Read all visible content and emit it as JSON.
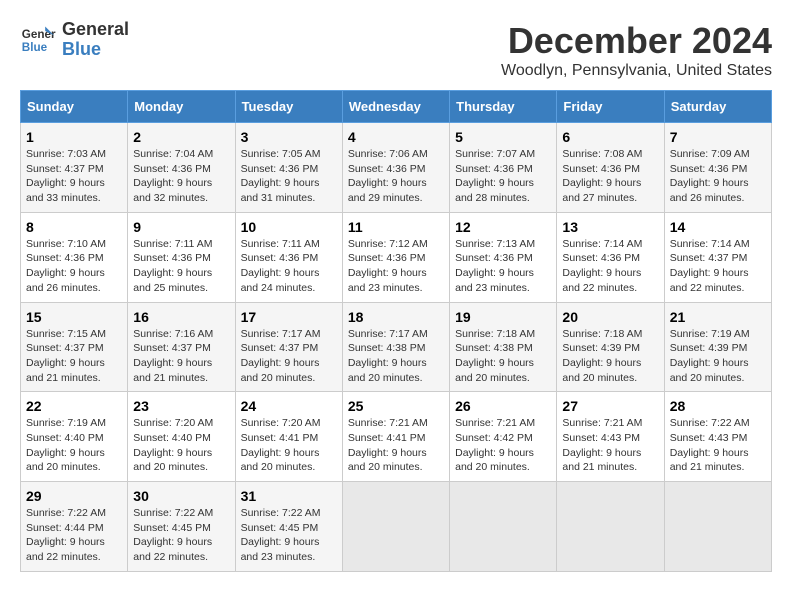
{
  "header": {
    "logo_line1": "General",
    "logo_line2": "Blue",
    "main_title": "December 2024",
    "subtitle": "Woodlyn, Pennsylvania, United States"
  },
  "columns": [
    "Sunday",
    "Monday",
    "Tuesday",
    "Wednesday",
    "Thursday",
    "Friday",
    "Saturday"
  ],
  "weeks": [
    [
      {
        "day": "1",
        "sunrise": "Sunrise: 7:03 AM",
        "sunset": "Sunset: 4:37 PM",
        "daylight": "Daylight: 9 hours and 33 minutes."
      },
      {
        "day": "2",
        "sunrise": "Sunrise: 7:04 AM",
        "sunset": "Sunset: 4:36 PM",
        "daylight": "Daylight: 9 hours and 32 minutes."
      },
      {
        "day": "3",
        "sunrise": "Sunrise: 7:05 AM",
        "sunset": "Sunset: 4:36 PM",
        "daylight": "Daylight: 9 hours and 31 minutes."
      },
      {
        "day": "4",
        "sunrise": "Sunrise: 7:06 AM",
        "sunset": "Sunset: 4:36 PM",
        "daylight": "Daylight: 9 hours and 29 minutes."
      },
      {
        "day": "5",
        "sunrise": "Sunrise: 7:07 AM",
        "sunset": "Sunset: 4:36 PM",
        "daylight": "Daylight: 9 hours and 28 minutes."
      },
      {
        "day": "6",
        "sunrise": "Sunrise: 7:08 AM",
        "sunset": "Sunset: 4:36 PM",
        "daylight": "Daylight: 9 hours and 27 minutes."
      },
      {
        "day": "7",
        "sunrise": "Sunrise: 7:09 AM",
        "sunset": "Sunset: 4:36 PM",
        "daylight": "Daylight: 9 hours and 26 minutes."
      }
    ],
    [
      {
        "day": "8",
        "sunrise": "Sunrise: 7:10 AM",
        "sunset": "Sunset: 4:36 PM",
        "daylight": "Daylight: 9 hours and 26 minutes."
      },
      {
        "day": "9",
        "sunrise": "Sunrise: 7:11 AM",
        "sunset": "Sunset: 4:36 PM",
        "daylight": "Daylight: 9 hours and 25 minutes."
      },
      {
        "day": "10",
        "sunrise": "Sunrise: 7:11 AM",
        "sunset": "Sunset: 4:36 PM",
        "daylight": "Daylight: 9 hours and 24 minutes."
      },
      {
        "day": "11",
        "sunrise": "Sunrise: 7:12 AM",
        "sunset": "Sunset: 4:36 PM",
        "daylight": "Daylight: 9 hours and 23 minutes."
      },
      {
        "day": "12",
        "sunrise": "Sunrise: 7:13 AM",
        "sunset": "Sunset: 4:36 PM",
        "daylight": "Daylight: 9 hours and 23 minutes."
      },
      {
        "day": "13",
        "sunrise": "Sunrise: 7:14 AM",
        "sunset": "Sunset: 4:36 PM",
        "daylight": "Daylight: 9 hours and 22 minutes."
      },
      {
        "day": "14",
        "sunrise": "Sunrise: 7:14 AM",
        "sunset": "Sunset: 4:37 PM",
        "daylight": "Daylight: 9 hours and 22 minutes."
      }
    ],
    [
      {
        "day": "15",
        "sunrise": "Sunrise: 7:15 AM",
        "sunset": "Sunset: 4:37 PM",
        "daylight": "Daylight: 9 hours and 21 minutes."
      },
      {
        "day": "16",
        "sunrise": "Sunrise: 7:16 AM",
        "sunset": "Sunset: 4:37 PM",
        "daylight": "Daylight: 9 hours and 21 minutes."
      },
      {
        "day": "17",
        "sunrise": "Sunrise: 7:17 AM",
        "sunset": "Sunset: 4:37 PM",
        "daylight": "Daylight: 9 hours and 20 minutes."
      },
      {
        "day": "18",
        "sunrise": "Sunrise: 7:17 AM",
        "sunset": "Sunset: 4:38 PM",
        "daylight": "Daylight: 9 hours and 20 minutes."
      },
      {
        "day": "19",
        "sunrise": "Sunrise: 7:18 AM",
        "sunset": "Sunset: 4:38 PM",
        "daylight": "Daylight: 9 hours and 20 minutes."
      },
      {
        "day": "20",
        "sunrise": "Sunrise: 7:18 AM",
        "sunset": "Sunset: 4:39 PM",
        "daylight": "Daylight: 9 hours and 20 minutes."
      },
      {
        "day": "21",
        "sunrise": "Sunrise: 7:19 AM",
        "sunset": "Sunset: 4:39 PM",
        "daylight": "Daylight: 9 hours and 20 minutes."
      }
    ],
    [
      {
        "day": "22",
        "sunrise": "Sunrise: 7:19 AM",
        "sunset": "Sunset: 4:40 PM",
        "daylight": "Daylight: 9 hours and 20 minutes."
      },
      {
        "day": "23",
        "sunrise": "Sunrise: 7:20 AM",
        "sunset": "Sunset: 4:40 PM",
        "daylight": "Daylight: 9 hours and 20 minutes."
      },
      {
        "day": "24",
        "sunrise": "Sunrise: 7:20 AM",
        "sunset": "Sunset: 4:41 PM",
        "daylight": "Daylight: 9 hours and 20 minutes."
      },
      {
        "day": "25",
        "sunrise": "Sunrise: 7:21 AM",
        "sunset": "Sunset: 4:41 PM",
        "daylight": "Daylight: 9 hours and 20 minutes."
      },
      {
        "day": "26",
        "sunrise": "Sunrise: 7:21 AM",
        "sunset": "Sunset: 4:42 PM",
        "daylight": "Daylight: 9 hours and 20 minutes."
      },
      {
        "day": "27",
        "sunrise": "Sunrise: 7:21 AM",
        "sunset": "Sunset: 4:43 PM",
        "daylight": "Daylight: 9 hours and 21 minutes."
      },
      {
        "day": "28",
        "sunrise": "Sunrise: 7:22 AM",
        "sunset": "Sunset: 4:43 PM",
        "daylight": "Daylight: 9 hours and 21 minutes."
      }
    ],
    [
      {
        "day": "29",
        "sunrise": "Sunrise: 7:22 AM",
        "sunset": "Sunset: 4:44 PM",
        "daylight": "Daylight: 9 hours and 22 minutes."
      },
      {
        "day": "30",
        "sunrise": "Sunrise: 7:22 AM",
        "sunset": "Sunset: 4:45 PM",
        "daylight": "Daylight: 9 hours and 22 minutes."
      },
      {
        "day": "31",
        "sunrise": "Sunrise: 7:22 AM",
        "sunset": "Sunset: 4:45 PM",
        "daylight": "Daylight: 9 hours and 23 minutes."
      },
      null,
      null,
      null,
      null
    ]
  ]
}
